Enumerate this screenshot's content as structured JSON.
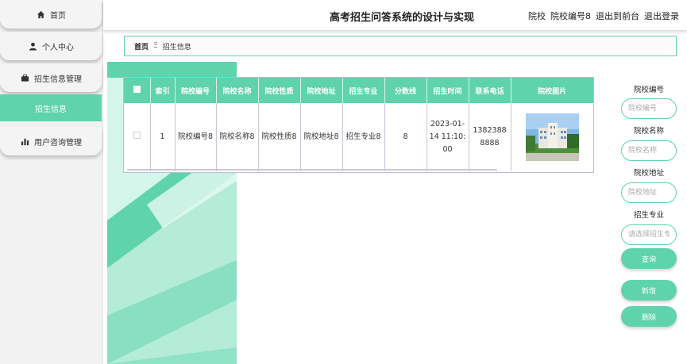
{
  "header": {
    "title": "高考招生问答系统的设计与实现",
    "user_role": "院校",
    "user_name": "院校编号8",
    "to_front": "退出到前台",
    "logout": "退出登录"
  },
  "sidebar": {
    "items": [
      {
        "label": "首页",
        "icon": "home-icon"
      },
      {
        "label": "个人中心",
        "icon": "user-icon"
      },
      {
        "label": "招生信息管理",
        "icon": "briefcase-icon"
      },
      {
        "label": "招生信息",
        "icon": "",
        "active": true
      },
      {
        "label": "用户咨询管理",
        "icon": "bar-chart-icon"
      }
    ]
  },
  "breadcrumb": {
    "home": "首页",
    "separator": "Ξ",
    "current": "招生信息"
  },
  "table": {
    "headers": [
      "索引",
      "院校编号",
      "院校名称",
      "院校性质",
      "院校地址",
      "招生专业",
      "分数线",
      "招生时间",
      "联系电话",
      "院校图片"
    ],
    "rows": [
      {
        "index": "1",
        "school_code": "院校编号8",
        "school_name": "院校名称8",
        "nature": "院校性质8",
        "address": "院校地址8",
        "major": "招生专业8",
        "score": "8",
        "time": "2023-01-14 11:10:00",
        "phone": "13823888888",
        "image": "campus-building-photo"
      }
    ]
  },
  "search": {
    "code_label": "院校编号",
    "code_placeholder": "院校编号",
    "name_label": "院校名称",
    "name_placeholder": "院校名称",
    "address_label": "院校地址",
    "address_placeholder": "院校地址",
    "major_label": "招生专业",
    "major_placeholder": "请选择招生专业",
    "query_button": "查询",
    "add_button": "新增",
    "delete_button": "删除"
  },
  "colors": {
    "accent": "#5fd3ac",
    "accent_dark": "#3fbf95",
    "table_border": "#b8bde0"
  }
}
